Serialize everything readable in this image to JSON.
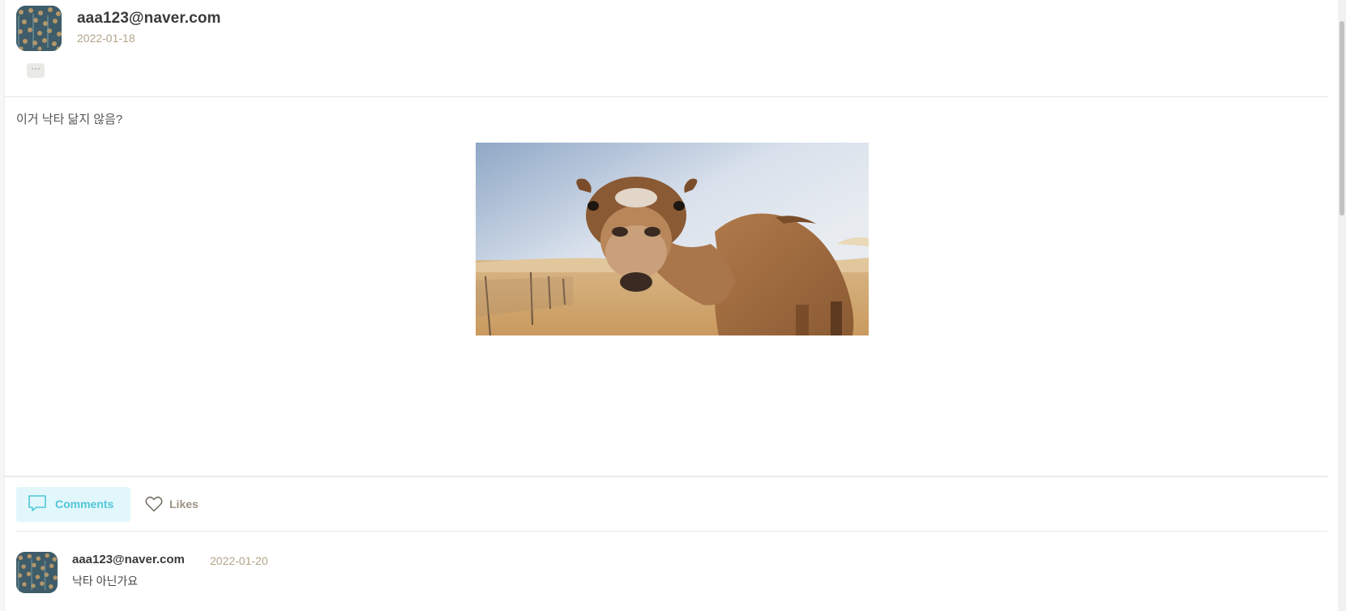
{
  "post": {
    "author": "aaa123@naver.com",
    "date": "2022-01-18",
    "more_label": "···",
    "text": "이거 낙타 닮지 않음?",
    "image_icon": "camel-photo"
  },
  "actions": {
    "comments_label": "Comments",
    "likes_label": "Likes",
    "comments_icon": "speech-bubble-icon",
    "likes_icon": "heart-icon",
    "accent_color": "#4fc6d8",
    "active_tab_bg": "#e2f7fb"
  },
  "comments": [
    {
      "author": "aaa123@naver.com",
      "date": "2022-01-20",
      "text": "낙타 아닌가요"
    }
  ]
}
